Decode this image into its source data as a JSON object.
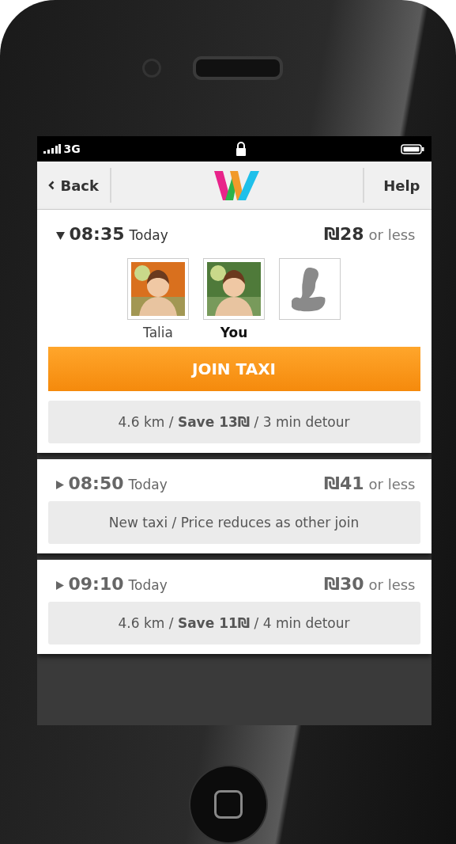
{
  "status_bar": {
    "network": "3G"
  },
  "nav": {
    "back": "Back",
    "help": "Help"
  },
  "rides": [
    {
      "time": "08:35",
      "day": "Today",
      "price": "₪28",
      "price_suffix": "or less",
      "expanded": true,
      "riders": [
        {
          "kind": "person",
          "name": "Talia",
          "current": false
        },
        {
          "kind": "person",
          "name": "You",
          "current": true
        },
        {
          "kind": "empty_seat"
        }
      ],
      "action": "JOIN TAXI",
      "info": "4.6 km / **Save 13₪** / 3 min detour"
    },
    {
      "time": "08:50",
      "day": "Today",
      "price": "₪41",
      "price_suffix": "or less",
      "expanded": false,
      "info": "New taxi / Price reduces as other join"
    },
    {
      "time": "09:10",
      "day": "Today",
      "price": "₪30",
      "price_suffix": "or less",
      "expanded": false,
      "info": "4.6 km / **Save 11₪** / 4 min detour"
    }
  ]
}
